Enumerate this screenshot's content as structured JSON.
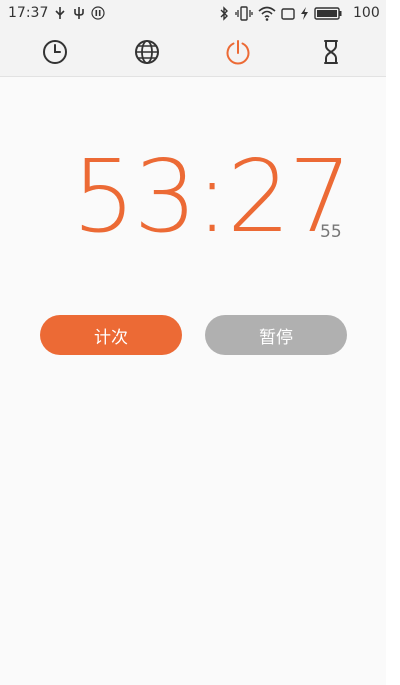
{
  "status_bar": {
    "time": "17:37",
    "battery_level": "100",
    "left_icons": [
      "usb-icon",
      "usb-debug-icon",
      "pause-icon"
    ],
    "right_icons": [
      "bluetooth-icon",
      "vibrate-icon",
      "wifi-icon",
      "sim-icon",
      "charging-icon",
      "battery-icon"
    ]
  },
  "tabs": [
    {
      "name": "clock-icon",
      "active": false
    },
    {
      "name": "globe-icon",
      "active": false
    },
    {
      "name": "stopwatch-icon",
      "active": true
    },
    {
      "name": "hourglass-icon",
      "active": false
    }
  ],
  "stopwatch": {
    "main_display": "53:27",
    "hundredths": "55"
  },
  "buttons": {
    "lap_label": "计次",
    "pause_label": "暂停"
  },
  "colors": {
    "accent": "#ec6a35",
    "inactive_button": "#b0b0b0",
    "tab_icon": "#333333"
  }
}
